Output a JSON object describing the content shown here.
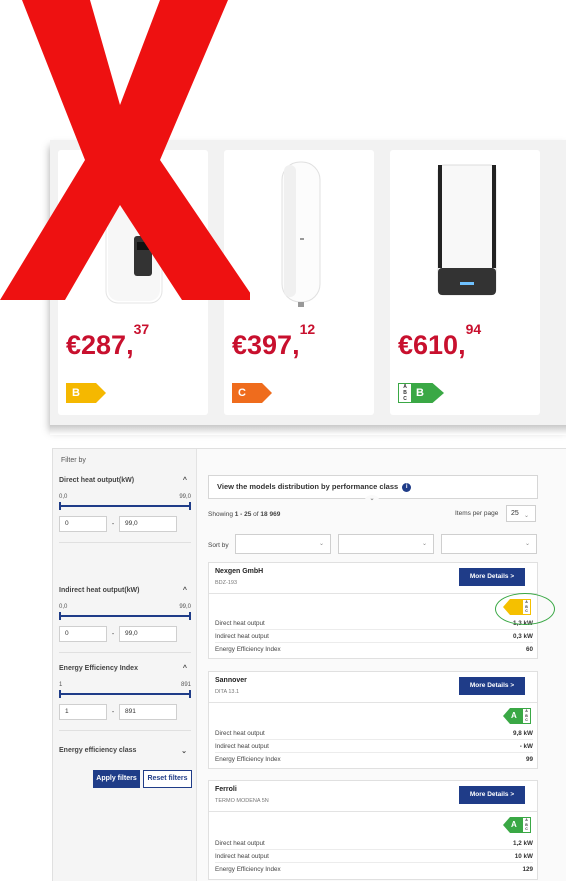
{
  "colors": {
    "price_red": "#c8102e",
    "brand_blue": "#1f3c88",
    "class_green": "#3aa845",
    "class_yellow": "#f5c000",
    "class_orange": "#ef6c1d",
    "annotation_red": "#ee1111"
  },
  "top_cards": [
    {
      "price_main": "€287,",
      "price_cents": "37",
      "energy_class": "B",
      "tag_color": "#f5b800"
    },
    {
      "price_main": "€397,",
      "price_cents": "12",
      "energy_class": "C",
      "tag_color": "#ef6c1d"
    },
    {
      "price_main": "€610,",
      "price_cents": "94",
      "energy_class": "B",
      "tag_color": "#3aa845",
      "scale_text": "A\nB\nC"
    }
  ],
  "sidebar": {
    "filter_title": "Filter by",
    "sections": [
      {
        "title": "Direct heat output(kW)",
        "min_label": "0,0",
        "max_label": "99,0",
        "min_value": "0",
        "max_value": "99,0"
      },
      {
        "title": "Indirect heat output(kW)",
        "min_label": "0,0",
        "max_label": "99,0",
        "min_value": "0",
        "max_value": "99,0"
      },
      {
        "title": "Energy Efficiency Index",
        "min_label": "1",
        "max_label": "891",
        "min_value": "1",
        "max_value": "891"
      }
    ],
    "class_section_title": "Energy efficiency class",
    "apply_label": "Apply filters",
    "reset_label": "Reset filters",
    "chevron_up": "^",
    "chevron_down": "⌄",
    "dash": "-"
  },
  "main": {
    "distribution_label": "View the models distribution by performance class",
    "info_glyph": "i",
    "showing_prefix": "Showing ",
    "showing_range": "1 - 25",
    "showing_of": " of ",
    "showing_total": "18 969",
    "items_per_page_label": "Items per page",
    "items_per_page_value": "25",
    "sort_by_label": "Sort by"
  },
  "products": [
    {
      "brand": "Nexgen GmbH",
      "model": "BDZ-193",
      "more_label": "More Details",
      "energy_class": "",
      "label_color": "#f5c000",
      "specs": [
        {
          "label": "Direct heat output",
          "value": "1,3 kW"
        },
        {
          "label": "Indirect heat output",
          "value": "0,3 kW"
        },
        {
          "label": "Energy Efficiency Index",
          "value": "60"
        }
      ]
    },
    {
      "brand": "Sannover",
      "model": "DITA 13.1",
      "more_label": "More Details",
      "energy_class": "A",
      "label_color": "#3aa845",
      "specs": [
        {
          "label": "Direct heat output",
          "value": "9,8 kW"
        },
        {
          "label": "Indirect heat output",
          "value": "- kW"
        },
        {
          "label": "Energy Efficiency Index",
          "value": "99"
        }
      ]
    },
    {
      "brand": "Ferroli",
      "model": "TERMO MODENA 5N",
      "more_label": "More Details",
      "energy_class": "A",
      "label_color": "#3aa845",
      "specs": [
        {
          "label": "Direct heat output",
          "value": "1,2 kW"
        },
        {
          "label": "Indirect heat output",
          "value": "10 kW"
        },
        {
          "label": "Energy Efficiency Index",
          "value": "129"
        }
      ]
    }
  ]
}
